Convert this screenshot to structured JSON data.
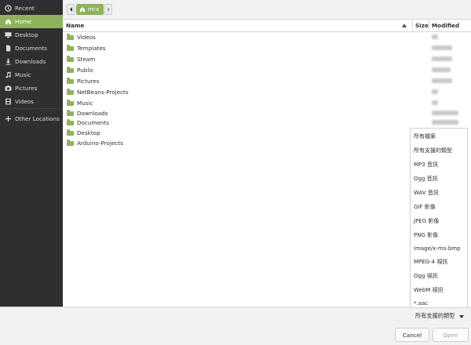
{
  "sidebar": {
    "items": [
      {
        "label": "Recent",
        "icon": "clock-icon"
      },
      {
        "label": "Home",
        "icon": "home-icon"
      },
      {
        "label": "Desktop",
        "icon": "desktop-icon"
      },
      {
        "label": "Documents",
        "icon": "document-icon"
      },
      {
        "label": "Downloads",
        "icon": "download-icon"
      },
      {
        "label": "Music",
        "icon": "music-icon"
      },
      {
        "label": "Pictures",
        "icon": "camera-icon"
      },
      {
        "label": "Videos",
        "icon": "film-icon"
      }
    ],
    "other_locations": {
      "label": "Other Locations",
      "icon": "plus-icon"
    },
    "active_color": "#8fb25c"
  },
  "pathbar": {
    "current": "mra",
    "current_icon": "home-icon"
  },
  "columns": {
    "name": "Name",
    "size": "Size",
    "modified": "Modified"
  },
  "files": [
    {
      "name": "Videos"
    },
    {
      "name": "Templates"
    },
    {
      "name": "Steam"
    },
    {
      "name": "Public"
    },
    {
      "name": "Pictures"
    },
    {
      "name": "NetBeans-Projects"
    },
    {
      "name": "Music"
    },
    {
      "name": "Downloads"
    },
    {
      "name": "Documents"
    },
    {
      "name": "Desktop"
    },
    {
      "name": "Arduino-Projects"
    }
  ],
  "filter_menu": {
    "options": [
      "所有檔案",
      "所有支援的類型",
      "MP3 音訊",
      "Ogg 音訊",
      "WAV 音訊",
      "GIF 影像",
      "JPEG 影像",
      "PNG 影像",
      "image/x-ms-bmp",
      "MPEG-4 視訊",
      "Ogg 視訊",
      "WebM 視訊",
      "*.aac"
    ],
    "selected": "所有支援的類型"
  },
  "buttons": {
    "cancel": "Cancel",
    "open": "Open"
  }
}
